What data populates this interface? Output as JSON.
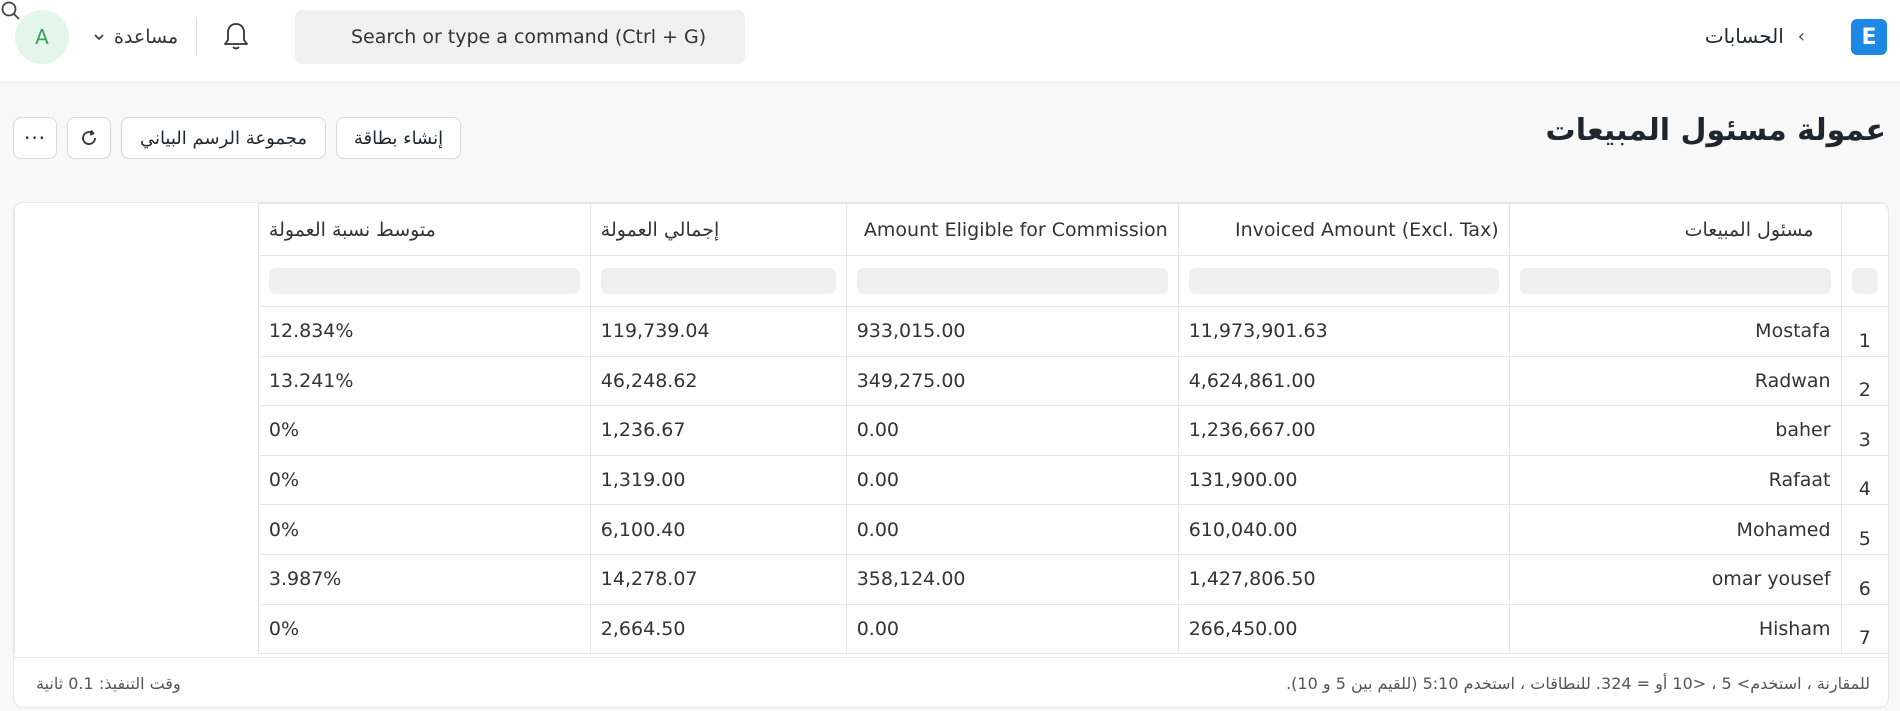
{
  "navbar": {
    "avatar_letter": "A",
    "help_label": "مساعدة",
    "search_placeholder": "Search or type a command (Ctrl + G)",
    "breadcrumb": "الحسابات",
    "logo_letter": "E"
  },
  "page": {
    "title": "عمولة مسئول المبيعات",
    "create_card_label": "إنشاء بطاقة",
    "chart_group_label": "مجموعة الرسم البياني",
    "more_label": "···"
  },
  "table": {
    "columns": [
      "مسئول المبيعات",
      "Invoiced Amount (Excl. Tax)",
      "Amount Eligible for Commission",
      "إجمالي العمولة",
      "متوسط نسبة العمولة"
    ],
    "rows": [
      {
        "idx": "1",
        "name": "Mostafa",
        "invoiced": "11,973,901.63",
        "eligible": "933,015.00",
        "total": "119,739.04",
        "rate": "12.834%"
      },
      {
        "idx": "2",
        "name": "Radwan",
        "invoiced": "4,624,861.00",
        "eligible": "349,275.00",
        "total": "46,248.62",
        "rate": "13.241%"
      },
      {
        "idx": "3",
        "name": "baher",
        "invoiced": "1,236,667.00",
        "eligible": "0.00",
        "total": "1,236.67",
        "rate": "0%"
      },
      {
        "idx": "4",
        "name": "Rafaat",
        "invoiced": "131,900.00",
        "eligible": "0.00",
        "total": "1,319.00",
        "rate": "0%"
      },
      {
        "idx": "5",
        "name": "Mohamed",
        "invoiced": "610,040.00",
        "eligible": "0.00",
        "total": "6,100.40",
        "rate": "0%"
      },
      {
        "idx": "6",
        "name": "omar yousef",
        "invoiced": "1,427,806.50",
        "eligible": "358,124.00",
        "total": "14,278.07",
        "rate": "3.987%"
      },
      {
        "idx": "7",
        "name": "Hisham",
        "invoiced": "266,450.00",
        "eligible": "0.00",
        "total": "2,664.50",
        "rate": "0%"
      }
    ]
  },
  "footer": {
    "hint": "للمقارنة ، استخدم> 5 ، <10 أو = 324. للنطاقات ، استخدم 5:10 (للقيم بين 5 و 10).",
    "exec_time": "وقت التنفيذ: 0.1 ثانية"
  },
  "colors": {
    "accent": "#1e88e5",
    "avatar_bg": "#e4f5e9",
    "avatar_fg": "#38a160"
  }
}
